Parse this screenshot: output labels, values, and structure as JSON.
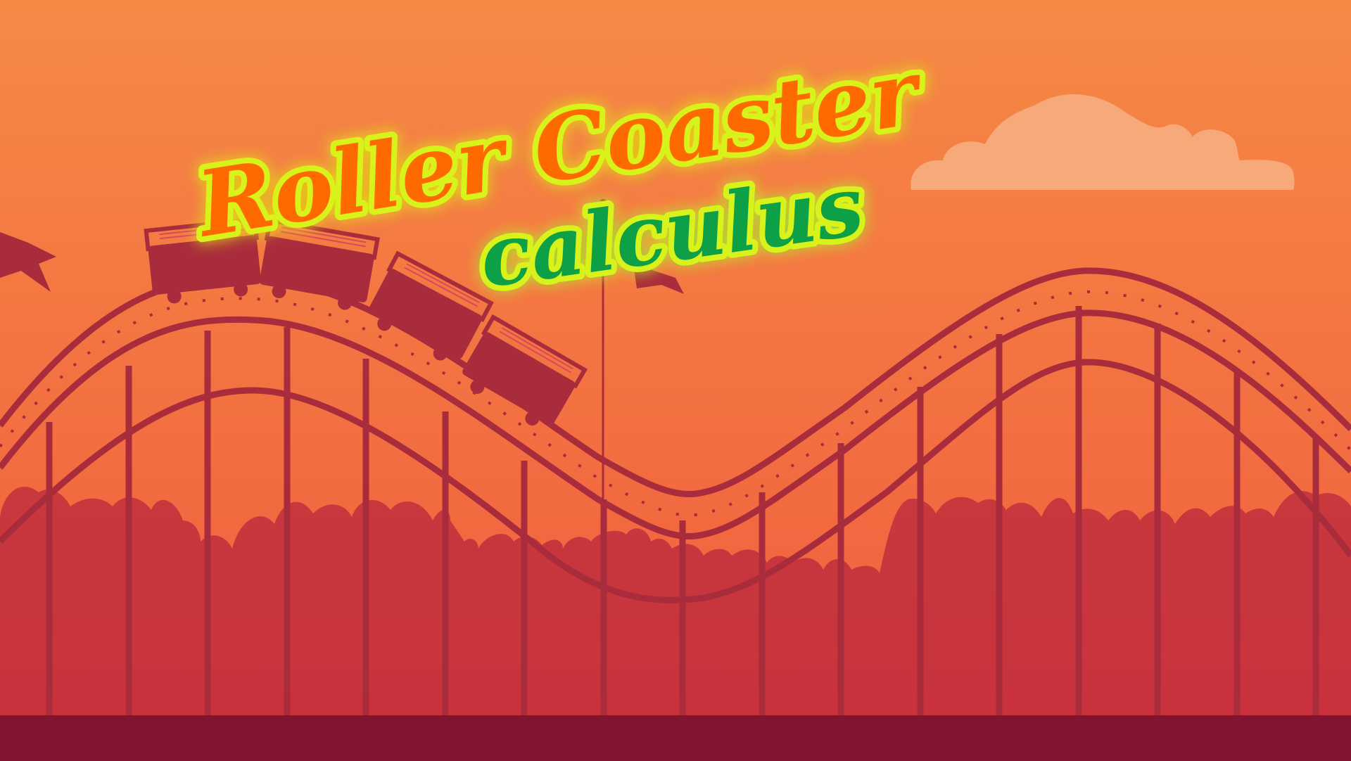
{
  "title": {
    "line1": "Roller Coaster",
    "line2": "calculus"
  },
  "colors": {
    "sky_top": "#F58A45",
    "sky_bottom": "#F15A3E",
    "coaster": "#A92C3C",
    "trees": "#C8383D",
    "ground": "#821430",
    "cloud": "#F8A979",
    "title_line1_fill": "#FF6A00",
    "title_line2_fill": "#0DA046",
    "title_outline": "#D8F21A"
  },
  "icons": [
    "cloud-icon",
    "flag-icon",
    "coaster-car-icon"
  ]
}
